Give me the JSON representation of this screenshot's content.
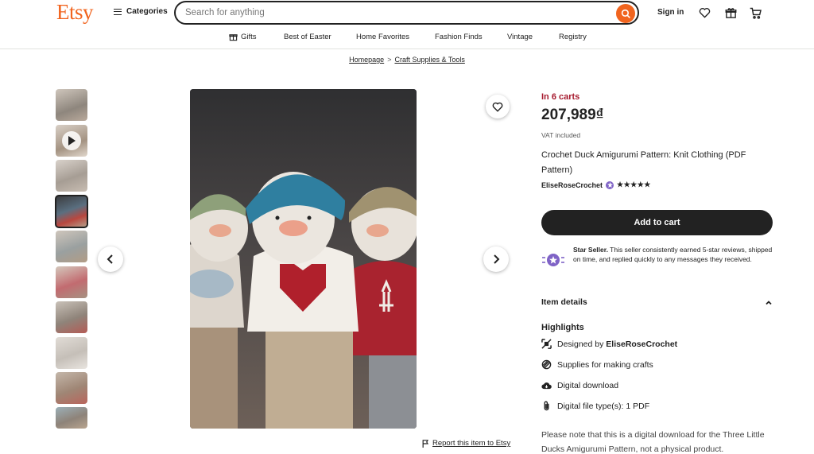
{
  "header": {
    "logo": "Etsy",
    "categories_label": "Categories",
    "search_placeholder": "Search for anything",
    "signin_label": "Sign in"
  },
  "nav": {
    "items": [
      "Gifts",
      "Best of Easter",
      "Home Favorites",
      "Fashion Finds",
      "Vintage",
      "Registry"
    ]
  },
  "breadcrumb": {
    "items": [
      "Homepage",
      "Craft Supplies & Tools"
    ],
    "separator": ">"
  },
  "gallery": {
    "thumbnail_count": 10,
    "active_index": 3,
    "video_index": 1,
    "report_label": "Report this item to Etsy"
  },
  "product": {
    "in_carts": "In 6 carts",
    "price": "207,989₫",
    "vat": "VAT included",
    "title": "Crochet Duck Amigurumi Pattern: Knit Clothing (PDF Pattern)",
    "shop_name": "EliseRoseCrochet",
    "rating_stars": "★★★★★",
    "add_to_cart": "Add to cart",
    "star_seller_title": "Star Seller.",
    "star_seller_text": "This seller consistently earned 5-star reviews, shipped on time, and replied quickly to any messages they received.",
    "item_details_label": "Item details",
    "highlights_label": "Highlights",
    "highlights": {
      "designed_by_prefix": "Designed by",
      "designed_by_name": "EliseRoseCrochet",
      "supplies": "Supplies for making crafts",
      "digital_download": "Digital download",
      "file_types": "Digital file type(s): 1 PDF"
    },
    "description": "Please note that this is a digital download for the Three Little Ducks Amigurumi Pattern, not a physical product."
  },
  "colors": {
    "brand_orange": "#F1641E",
    "carts_red": "#A61A2E",
    "button_dark": "#222222",
    "star_seller_purple": "#7F63C6"
  },
  "icons": [
    "search-icon",
    "heart-icon",
    "gift-icon",
    "cart-icon",
    "chevron-left-icon",
    "chevron-right-icon",
    "flag-icon",
    "star-seller-icon",
    "chevron-up-icon",
    "design-icon",
    "supplies-icon",
    "download-icon",
    "paperclip-icon",
    "play-icon"
  ]
}
